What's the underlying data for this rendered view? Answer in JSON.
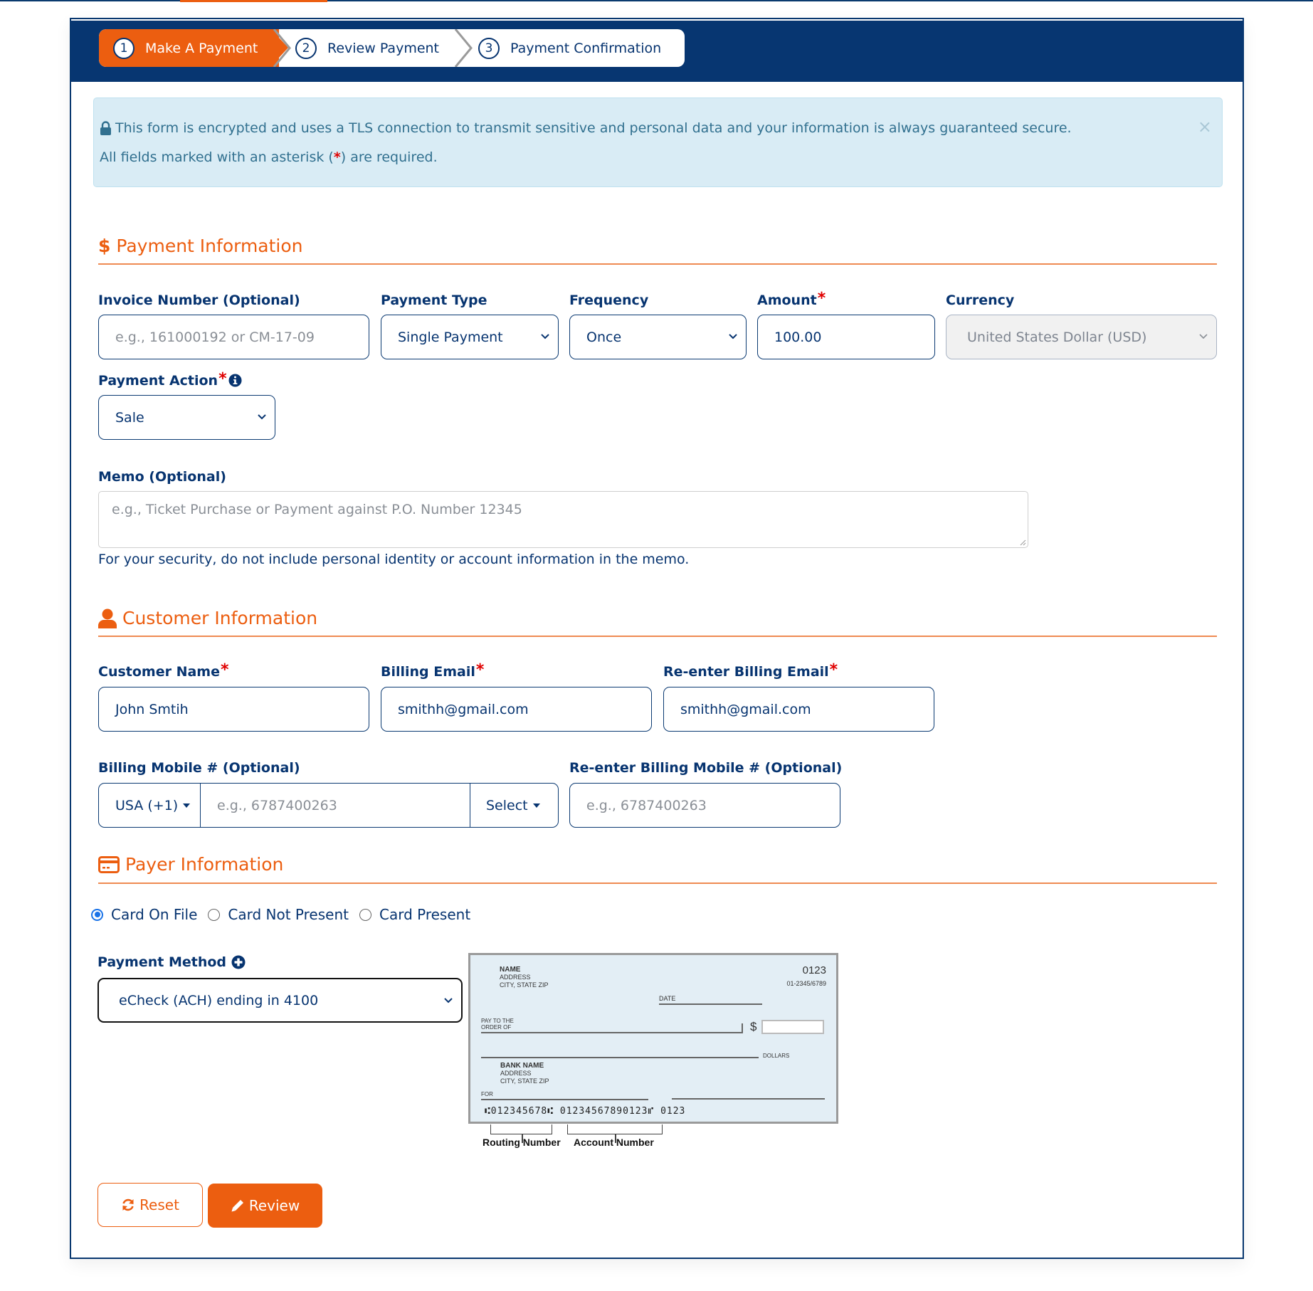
{
  "stepper": {
    "steps": [
      {
        "number": "1",
        "label": "Make A Payment",
        "active": true
      },
      {
        "number": "2",
        "label": "Review Payment",
        "active": false
      },
      {
        "number": "3",
        "label": "Payment Confirmation",
        "active": false
      }
    ]
  },
  "alert": {
    "line1": "This form is encrypted and uses a TLS connection to transmit sensitive and personal data and your information is always guaranteed secure.",
    "line2_prefix": "All fields marked with an asterisk (",
    "line2_star": "*",
    "line2_suffix": ") are required.",
    "close": "×"
  },
  "payment_info": {
    "title": "Payment Information",
    "invoice": {
      "label": "Invoice Number (Optional)",
      "placeholder": "e.g., 161000192 or CM-17-09",
      "value": ""
    },
    "payment_type": {
      "label": "Payment Type",
      "value": "Single Payment"
    },
    "frequency": {
      "label": "Frequency",
      "value": "Once"
    },
    "amount": {
      "label": "Amount",
      "required": "*",
      "value": "100.00"
    },
    "currency": {
      "label": "Currency",
      "value": "United States Dollar (USD)"
    },
    "payment_action": {
      "label": "Payment Action",
      "required": "*",
      "value": "Sale"
    },
    "memo": {
      "label": "Memo (Optional)",
      "placeholder": "e.g., Ticket Purchase or Payment against P.O. Number 12345",
      "value": ""
    },
    "memo_help": "For your security, do not include personal identity or account information in the memo."
  },
  "customer_info": {
    "title": "Customer Information",
    "customer_name": {
      "label": "Customer Name",
      "required": "*",
      "value": "John Smtih"
    },
    "billing_email": {
      "label": "Billing Email",
      "required": "*",
      "value": "smithh@gmail.com"
    },
    "reenter_email": {
      "label": "Re-enter Billing Email",
      "required": "*",
      "value": "smithh@gmail.com"
    },
    "billing_mobile": {
      "label": "Billing Mobile # (Optional)",
      "country_code": "USA (+1)",
      "placeholder": "e.g., 6787400263",
      "carrier": "Select"
    },
    "reenter_mobile": {
      "label": "Re-enter Billing Mobile # (Optional)",
      "placeholder": "e.g., 6787400263"
    }
  },
  "payer_info": {
    "title": "Payer Information",
    "modes": [
      {
        "label": "Card On File",
        "checked": true
      },
      {
        "label": "Card Not Present",
        "checked": false
      },
      {
        "label": "Card Present",
        "checked": false
      }
    ],
    "payment_method": {
      "label": "Payment Method",
      "value": "eCheck (ACH) ending in 4100"
    }
  },
  "check_image": {
    "name": "NAME",
    "address": "ADDRESS",
    "city": "CITY, STATE  ZIP",
    "check_number": "0123",
    "fraction": "01-2345/6789",
    "date": "DATE",
    "pay_to_1": "PAY TO THE",
    "pay_to_2": "ORDER OF",
    "dollar_sign": "$",
    "dollars": "DOLLARS",
    "bank_name": "BANK NAME",
    "bank_address": "ADDRESS",
    "bank_city": "CITY, STATE  ZIP",
    "for": "FOR",
    "micr": "⑆012345678⑆ 01234567890123⑈ 0123",
    "routing_label": "Routing Number",
    "account_label": "Account Number"
  },
  "actions": {
    "reset": "Reset",
    "review": "Review"
  },
  "colors": {
    "brand_navy": "#073671",
    "accent_orange": "#ec5e10",
    "alert_bg": "#d9ecf5",
    "required_red": "#e00000"
  }
}
